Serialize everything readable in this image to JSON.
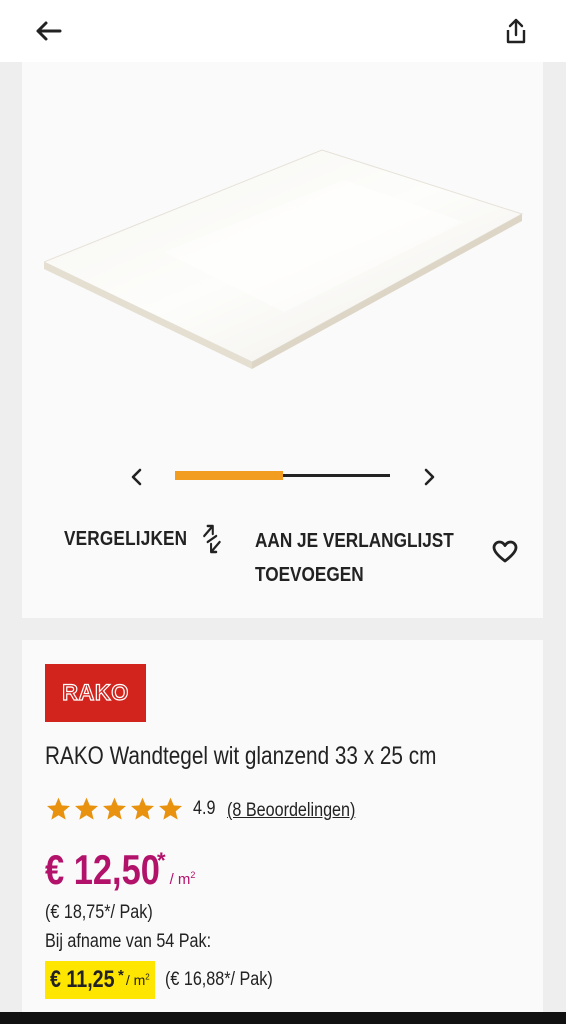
{
  "header": {
    "back_icon": "arrow-left-icon",
    "share_icon": "share-icon"
  },
  "gallery": {
    "prev_icon": "chevron-left-icon",
    "next_icon": "chevron-right-icon",
    "progress": 0.5,
    "accent_color": "#f29d1f"
  },
  "actions": {
    "compare_label": "VERGELIJKEN",
    "wishlist_label_line1": "AAN JE VERLANGLIJST",
    "wishlist_label_line2": "TOEVOEGEN"
  },
  "product": {
    "brand_logo_text": "RAKO",
    "brand_color": "#d2231d",
    "title": "RAKO Wandtegel wit glanzend 33 x 25 cm",
    "rating": 5,
    "rating_value": "4.9",
    "reviews": "(8 Beoordelingen)",
    "price": "€ 12,50",
    "price_asterisk": "*",
    "price_unit": "/ m",
    "price_unit_sup": "2",
    "price_color": "#b3126b",
    "pack_price": "(€ 18,75*/ Pak)",
    "bulk_label": "Bij afname van 54 Pak:",
    "bulk_price": "€ 11,25",
    "bulk_asterisk": "*",
    "bulk_unit": "/ m",
    "bulk_unit_sup": "2",
    "bulk_pack_price": "(€ 16,88*/ Pak)",
    "highlight_color": "#ffe600"
  }
}
